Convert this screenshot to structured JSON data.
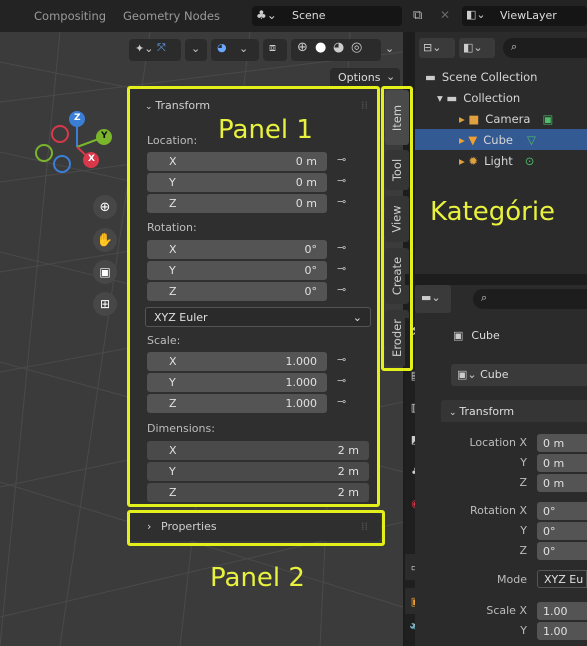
{
  "topbar": {
    "tabs": [
      "Compositing",
      "Geometry Nodes"
    ],
    "scene": "Scene",
    "view_layer": "ViewLayer"
  },
  "viewport": {
    "options_label": "Options",
    "gizmo": {
      "z": "Z",
      "y": "Y",
      "x": "X"
    }
  },
  "npanel": {
    "transform_title": "Transform",
    "location_label": "Location:",
    "location": [
      {
        "axis": "X",
        "value": "0 m"
      },
      {
        "axis": "Y",
        "value": "0 m"
      },
      {
        "axis": "Z",
        "value": "0 m"
      }
    ],
    "rotation_label": "Rotation:",
    "rotation": [
      {
        "axis": "X",
        "value": "0°"
      },
      {
        "axis": "Y",
        "value": "0°"
      },
      {
        "axis": "Z",
        "value": "0°"
      }
    ],
    "rotation_mode": "XYZ Euler",
    "scale_label": "Scale:",
    "scale": [
      {
        "axis": "X",
        "value": "1.000"
      },
      {
        "axis": "Y",
        "value": "1.000"
      },
      {
        "axis": "Z",
        "value": "1.000"
      }
    ],
    "dimensions_label": "Dimensions:",
    "dimensions": [
      {
        "axis": "X",
        "value": "2 m"
      },
      {
        "axis": "Y",
        "value": "2 m"
      },
      {
        "axis": "Z",
        "value": "2 m"
      }
    ],
    "properties_title": "Properties"
  },
  "side_tabs": [
    "Item",
    "Tool",
    "View",
    "Create",
    "Eroder"
  ],
  "outliner": {
    "scene_collection": "Scene Collection",
    "collection": "Collection",
    "items": [
      "Camera",
      "Cube",
      "Light"
    ]
  },
  "properties": {
    "object_name": "Cube",
    "mesh_name": "Cube",
    "transform_title": "Transform",
    "rows": [
      {
        "label": "Location X",
        "value": "0 m"
      },
      {
        "label": "Y",
        "value": "0 m"
      },
      {
        "label": "Z",
        "value": "0 m"
      },
      {
        "label": "Rotation X",
        "value": "0°"
      },
      {
        "label": "Y",
        "value": "0°"
      },
      {
        "label": "Z",
        "value": "0°"
      },
      {
        "label": "Mode",
        "value": "XYZ Eu"
      },
      {
        "label": "Scale X",
        "value": "1.00"
      },
      {
        "label": "Y",
        "value": "1.00"
      }
    ]
  },
  "annotations": {
    "panel1": "Panel 1",
    "panel2": "Panel 2",
    "category": "Kategórie"
  },
  "colors": {
    "annotation": "#e4f01a",
    "selection": "#335a92"
  }
}
